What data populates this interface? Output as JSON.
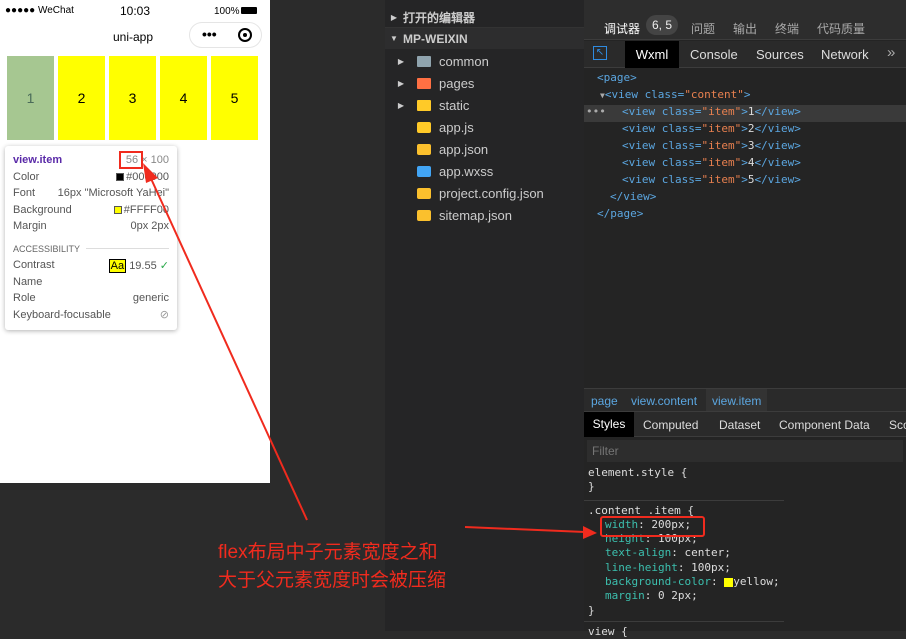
{
  "phone": {
    "status": {
      "signal": "●●●●● WeChat",
      "wifi_icon": "wifi-icon",
      "time": "10:03",
      "battery": "100%"
    },
    "title": "uni-app",
    "menu": "•••",
    "items": [
      "1",
      "2",
      "3",
      "4",
      "5"
    ],
    "tooltip": {
      "selector": "view.item",
      "width": "56",
      "size_rest": "× 100",
      "rows": [
        {
          "label": "Color",
          "value": "#000000",
          "swatch": "#000000"
        },
        {
          "label": "Font",
          "value": "16px \"Microsoft YaHei\""
        },
        {
          "label": "Background",
          "value": "#FFFF00",
          "swatch": "#FFFF00"
        },
        {
          "label": "Margin",
          "value": "0px 2px"
        }
      ],
      "accessibility": "ACCESSIBILITY",
      "contrast_label": "Contrast",
      "contrast_badge": "Aa",
      "contrast_value": "19.55",
      "name_label": "Name",
      "role_label": "Role",
      "role_value": "generic",
      "kbd_label": "Keyboard-focusable"
    }
  },
  "explorer": {
    "open_editors": "打开的编辑器",
    "project": "MP-WEIXIN",
    "files": [
      {
        "name": "common",
        "icon": "folder-icon",
        "color": "#90a4ae",
        "arrow": true
      },
      {
        "name": "pages",
        "icon": "folder-pages-icon",
        "color": "#ff7043",
        "arrow": true
      },
      {
        "name": "static",
        "icon": "folder-static-icon",
        "color": "#ffca28",
        "arrow": true
      },
      {
        "name": "app.js",
        "icon": "js-file-icon",
        "color": "#ffca28"
      },
      {
        "name": "app.json",
        "icon": "json-file-icon",
        "color": "#fbc02d"
      },
      {
        "name": "app.wxss",
        "icon": "css-file-icon",
        "color": "#42a5f5"
      },
      {
        "name": "project.config.json",
        "icon": "json-file-icon",
        "color": "#fbc02d"
      },
      {
        "name": "sitemap.json",
        "icon": "json-file-icon",
        "color": "#fbc02d"
      }
    ]
  },
  "devtools": {
    "top_tabs": [
      "调试器",
      "问题",
      "输出",
      "终端",
      "代码质量"
    ],
    "badge": "6, 5",
    "tabs": [
      "Wxml",
      "Console",
      "Sources",
      "Network"
    ],
    "more": "»",
    "wxml": {
      "page_open": "<page>",
      "content_open_tag": "<view class=",
      "content_class": "\"content\"",
      "close_bracket": ">",
      "item_open": "<view class=",
      "item_class": "\"item\"",
      "item_close": "</view>",
      "items": [
        "1",
        "2",
        "3",
        "4",
        "5"
      ],
      "content_close": "</view>",
      "page_close": "</page>",
      "more": "•••"
    },
    "breadcrumb": [
      "page",
      "view.content",
      "view.item"
    ],
    "style_tabs": [
      "Styles",
      "Computed",
      "Dataset",
      "Component Data",
      "Sco"
    ],
    "filter_placeholder": "Filter",
    "element_style": "element.style {",
    "close_brace": "}",
    "rule_selector": ".content .item {",
    "props": [
      {
        "p": "width",
        "v": "200px;"
      },
      {
        "p": "height",
        "v": "100px;"
      },
      {
        "p": "text-align",
        "v": "center;"
      },
      {
        "p": "line-height",
        "v": "100px;"
      },
      {
        "p": "background-color",
        "v": "yellow;",
        "swatch": "#ffff00"
      },
      {
        "p": "margin",
        "v": "0 2px;"
      }
    ],
    "next_rule": "view {"
  },
  "annotation": {
    "line1": "flex布局中子元素宽度之和",
    "line2": "大于父元素宽度时会被压缩",
    "color": "#f02b1e"
  }
}
